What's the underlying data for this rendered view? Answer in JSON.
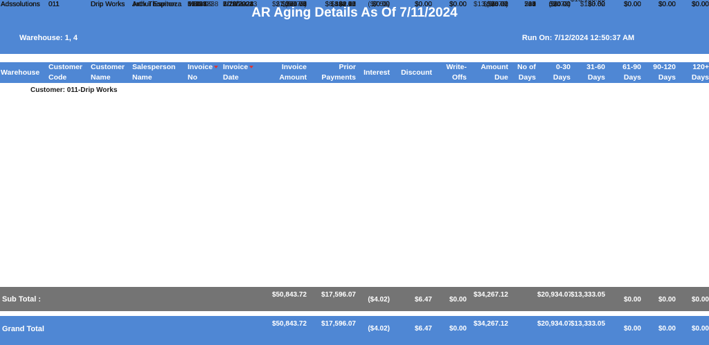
{
  "header": {
    "title": "AR Aging Details As Of 7/11/2024",
    "warehouse": "Warehouse: 1, 4",
    "run_on": "Run On: 7/12/2024 12:50:37 AM",
    "bg_color": "#4f87d4"
  },
  "columns": [
    "Warehouse",
    "Customer Code",
    "Customer Name",
    "Salesperson Name",
    "Invoice No",
    "Invoice Date",
    "Invoice Amount",
    "Prior Payments",
    "Interest",
    "Discount",
    "Write-Offs",
    "Amount Due",
    "No of Days",
    "0-30 Days",
    "31-60 Days",
    "61-90 Days",
    "90-120 Days",
    "120+ Days"
  ],
  "group_label": "Customer:  011-Drip Works",
  "rows": [
    [
      "Adssolutions",
      "011",
      "Drip Works",
      "Arthur Espinoza",
      "19534",
      "6/7/2022",
      "$256.77",
      "$480.77",
      "$0.00",
      "$0.00",
      "$0.00",
      "$0.00",
      "765",
      "$0.00",
      "$0.00",
      "$0.00",
      "$0.00",
      "$0.00"
    ],
    [
      "Adssolutions",
      "011",
      "Drip Works",
      "Arthur Espinoza",
      "31991",
      "2/20/2023",
      "$372.78",
      "$392.83",
      "$0.00",
      "$0.00",
      "$0.00",
      "$0.00",
      "507",
      "$0.00",
      "$0.00",
      "$0.00",
      "$0.00",
      "$0.00"
    ],
    [
      "Adssolutions",
      "011",
      "Drip Works",
      "Arthur Espinoza",
      "55266",
      "11/30/2023",
      "$7,350.00",
      "$8,128.41",
      "$0.00",
      "$0.00",
      "$0.00",
      "$0.00",
      "224",
      "$0.00",
      "$0.00",
      "$0.00",
      "$0.00",
      "$0.00"
    ],
    [
      "Adssolutions",
      "011",
      "Drip Works",
      "Arthur Espinoza",
      "65415",
      "5/29/2024",
      "$21,700.00",
      "$8,591.95",
      "($7.50)",
      "$0.00",
      "$0.00",
      "$13,108.05",
      "43",
      "$0.00",
      "$13,108.05",
      "$0.00",
      "$0.00",
      "$0.00"
    ],
    [
      "Adssolutions",
      "011",
      "Drip Works",
      "Arthur Espinoza",
      "65782",
      "6/10/2024",
      "$185.54",
      "$2.11",
      "$0.09",
      "$0.00",
      "$0.00",
      "$183.52",
      "31",
      "$0.00",
      "$183.52",
      "$0.00",
      "$0.00",
      "$0.00"
    ],
    [
      "Adssolutions",
      "011",
      "Drip Works",
      "Jack Thornton",
      "MBC1838",
      "7/10/2024",
      "$20.00",
      "$0.00",
      "$0.00",
      "$0.00",
      "$0.00",
      "$20.00",
      "1",
      "$20.00",
      "$0.00",
      "$0.00",
      "$0.00",
      "$0.00"
    ],
    [
      "Adssolutions",
      "011",
      "Drip Works",
      "Jack Thornton",
      "67018",
      "7/11/2024",
      "$74.21",
      "$0.00",
      "$0.00",
      "$0.00",
      "$0.00",
      "$74.21",
      "0",
      "$74.21",
      "$0.00",
      "$0.00",
      "$0.00",
      "$0.00"
    ],
    [
      "Adssolutions",
      "011",
      "Drip Works",
      "Jack Thornton",
      "M66409",
      "7/11/2024",
      "($8.72)",
      "$0.00",
      "$0.00",
      "$0.00",
      "$0.00",
      "($8.72)",
      "0",
      "($8.72)",
      "$0.00",
      "$0.00",
      "$0.00",
      "$0.00"
    ]
  ],
  "subtotal": {
    "label": "Sub Total :",
    "values": [
      "$50,843.72",
      "$17,596.07",
      "($4.02)",
      "$6.47",
      "$0.00",
      "$34,267.12",
      "",
      "$20,934.07",
      "$13,333.05",
      "$0.00",
      "$0.00",
      "$0.00"
    ],
    "bg_color": "#747474"
  },
  "grandtotal": {
    "label": "Grand Total",
    "values": [
      "$50,843.72",
      "$17,596.07",
      "($4.02)",
      "$6.47",
      "$0.00",
      "$34,267.12",
      "",
      "$20,934.07",
      "$13,333.05",
      "$0.00",
      "$0.00",
      "$0.00"
    ],
    "bg_color": "#4f87d4"
  }
}
